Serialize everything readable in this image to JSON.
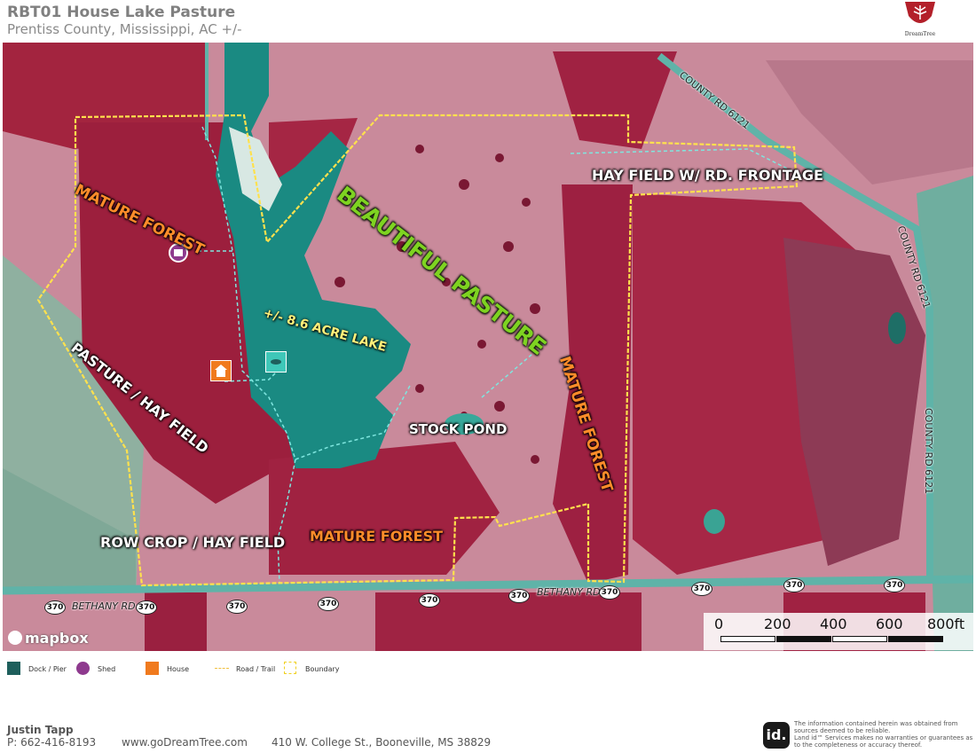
{
  "header": {
    "title": "RBT01 House Lake Pasture",
    "subtitle": "Prentiss County, Mississippi,  AC +/-"
  },
  "logo": {
    "text": "DreamTree"
  },
  "map": {
    "labels": {
      "mature_forest_nw": "MATURE FOREST",
      "beautiful_pasture": "BEAUTIFUL PASTURE",
      "hay_field_frontage": "HAY FIELD W/ RD. FRONTAGE",
      "lake": "+/- 8.6 ACRE LAKE",
      "pasture_hay_field": "PASTURE / HAY FIELD",
      "stock_pond": "STOCK POND",
      "mature_forest_e": "MATURE FOREST",
      "mature_forest_s": "MATURE FOREST",
      "row_crop_hay_field": "ROW CROP / HAY FIELD"
    },
    "roads": {
      "county_rd_top": "COUNTY RD 6121",
      "county_rd_mid": "COUNTY RD 6121",
      "county_rd_low": "COUNTY RD 6121",
      "bethany_rd_left": "BETHANY RD",
      "bethany_rd_right": "BETHANY RD",
      "shield_number": "370"
    },
    "attribution": "mapbox",
    "scale": {
      "ticks": [
        "0",
        "200",
        "400",
        "600",
        "800ft"
      ]
    },
    "colors": {
      "boundary": "#ffe14d",
      "trail": "#7fe6df",
      "water": "#1a8a82",
      "forest": "#b8244e",
      "pasture": "#c9899b"
    }
  },
  "legend": {
    "items": [
      {
        "icon": "dock-icon",
        "label": "Dock  /  Pier",
        "color": "#1e5f5c"
      },
      {
        "icon": "shed-icon",
        "label": "Shed",
        "color": "#8e3a8e"
      },
      {
        "icon": "house-icon",
        "label": "House",
        "color": "#f07a1e"
      },
      {
        "icon": "trail-icon",
        "label": "Road / Trail",
        "color": "#f0c040"
      },
      {
        "icon": "boundary-icon",
        "label": "Boundary",
        "color": "#f0d020"
      }
    ]
  },
  "footer": {
    "name": "Justin Tapp",
    "phone": "P: 662-416-8193",
    "website": "www.goDreamTree.com",
    "address": "410 W. College St., Booneville, MS 38829",
    "badge": "id.",
    "disclaimer": "The information contained herein was obtained from sources deemed to be reliable.\nLand id™ Services makes no warranties or guarantees as to the completeness or accuracy thereof."
  }
}
